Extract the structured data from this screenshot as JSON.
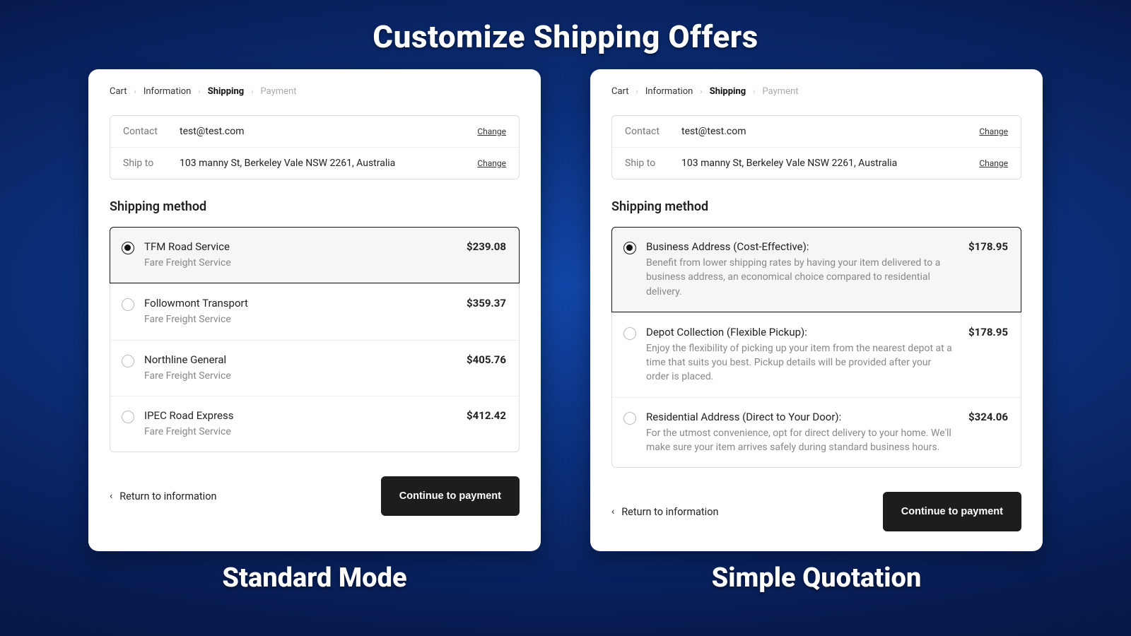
{
  "headline": "Customize Shipping Offers",
  "captions": {
    "left": "Standard Mode",
    "right": "Simple Quotation"
  },
  "breadcrumb": {
    "items": [
      {
        "label": "Cart",
        "kind": "link"
      },
      {
        "label": "Information",
        "kind": "link"
      },
      {
        "label": "Shipping",
        "kind": "current"
      },
      {
        "label": "Payment",
        "kind": "future"
      }
    ]
  },
  "contact": {
    "label": "Contact",
    "value": "test@test.com",
    "change": "Change"
  },
  "shipto": {
    "label": "Ship to",
    "value": "103 manny St, Berkeley Vale NSW 2261, Australia",
    "change": "Change"
  },
  "section_title": "Shipping method",
  "left": {
    "options": [
      {
        "title": "TFM Road Service",
        "sub": "Fare Freight Service",
        "price": "$239.08",
        "selected": true
      },
      {
        "title": "Followmont Transport",
        "sub": "Fare Freight Service",
        "price": "$359.37",
        "selected": false
      },
      {
        "title": "Northline General",
        "sub": "Fare Freight Service",
        "price": "$405.76",
        "selected": false
      },
      {
        "title": "IPEC Road Express",
        "sub": "Fare Freight Service",
        "price": "$412.42",
        "selected": false
      }
    ]
  },
  "right": {
    "options": [
      {
        "title": "Business Address (Cost-Effective):",
        "sub": "Benefit from lower shipping rates by having your item delivered to a business address, an economical choice compared to residential delivery.",
        "price": "$178.95",
        "selected": true
      },
      {
        "title": "Depot Collection (Flexible Pickup):",
        "sub": "Enjoy the flexibility of picking up your item from the nearest depot at a time that suits you best. Pickup details will be provided after your order is placed.",
        "price": "$178.95",
        "selected": false
      },
      {
        "title": "Residential Address (Direct to Your Door):",
        "sub": "For the utmost convenience, opt for direct delivery to your home. We'll make sure your item arrives safely during standard business hours.",
        "price": "$324.06",
        "selected": false
      }
    ]
  },
  "footer": {
    "back": "Return to information",
    "continue": "Continue to payment"
  }
}
